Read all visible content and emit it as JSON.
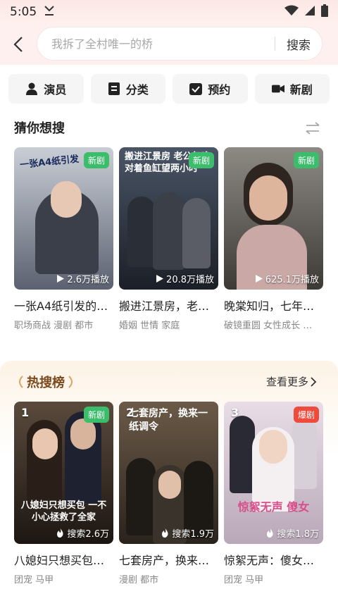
{
  "status": {
    "time": "5:05"
  },
  "search": {
    "placeholder": "我拆了全村唯一的桥",
    "button": "搜索"
  },
  "tabs": [
    {
      "label": "演员",
      "icon": "person-icon"
    },
    {
      "label": "分类",
      "icon": "list-icon"
    },
    {
      "label": "预约",
      "icon": "checkbox-icon"
    },
    {
      "label": "新剧",
      "icon": "video-camera-icon"
    }
  ],
  "guess": {
    "title": "猜你想搜",
    "cards": [
      {
        "title": "一张A4纸引发的…",
        "tags": "职场商战 漫剧 都市",
        "badge": "新剧",
        "plays": "2.6万播放",
        "poster_text": "一张A4纸引发",
        "colors": [
          "#c9ced6",
          "#5b6170"
        ]
      },
      {
        "title": "搬进江景房，老…",
        "tags": "婚姻 世情 家庭",
        "badge": "新剧",
        "plays": "20.8万播放",
        "poster_text": "搬进江景房 老公每晚对着鱼缸望两小时",
        "colors": [
          "#4a5566",
          "#1b1f27"
        ]
      },
      {
        "title": "晚棠知归，七年…",
        "tags": "破镜重圆 女性成长 …",
        "badge": "新剧",
        "plays": "625.1万播放",
        "poster_text": "",
        "colors": [
          "#8d8a84",
          "#3d3a36"
        ]
      }
    ]
  },
  "hot": {
    "title": "热搜榜",
    "more": "查看更多",
    "cards": [
      {
        "rank": "1",
        "title": "八媳妇只想买包…",
        "tags": "团宠 马甲",
        "badge": "新剧",
        "badge_type": "new",
        "plays": "搜索2.6万",
        "poster_text": "八媳妇只想买包 一不小心拯救了全家",
        "colors": [
          "#5a4a3c",
          "#1c1612"
        ]
      },
      {
        "rank": "2",
        "title": "七套房产，换来…",
        "tags": "漫剧 都市",
        "badge": "",
        "badge_type": "",
        "plays": "搜索1.9万",
        "poster_text": "七套房产，换来一纸调令",
        "colors": [
          "#6b5a48",
          "#2a231c"
        ]
      },
      {
        "rank": "3",
        "title": "惊絮无声：傻女…",
        "tags": "团宠 马甲",
        "badge": "爆剧",
        "badge_type": "hot",
        "plays": "搜索1.8万",
        "poster_text": "惊絮无声 傻女",
        "colors": [
          "#e8dde6",
          "#b9a8b8"
        ]
      }
    ]
  }
}
